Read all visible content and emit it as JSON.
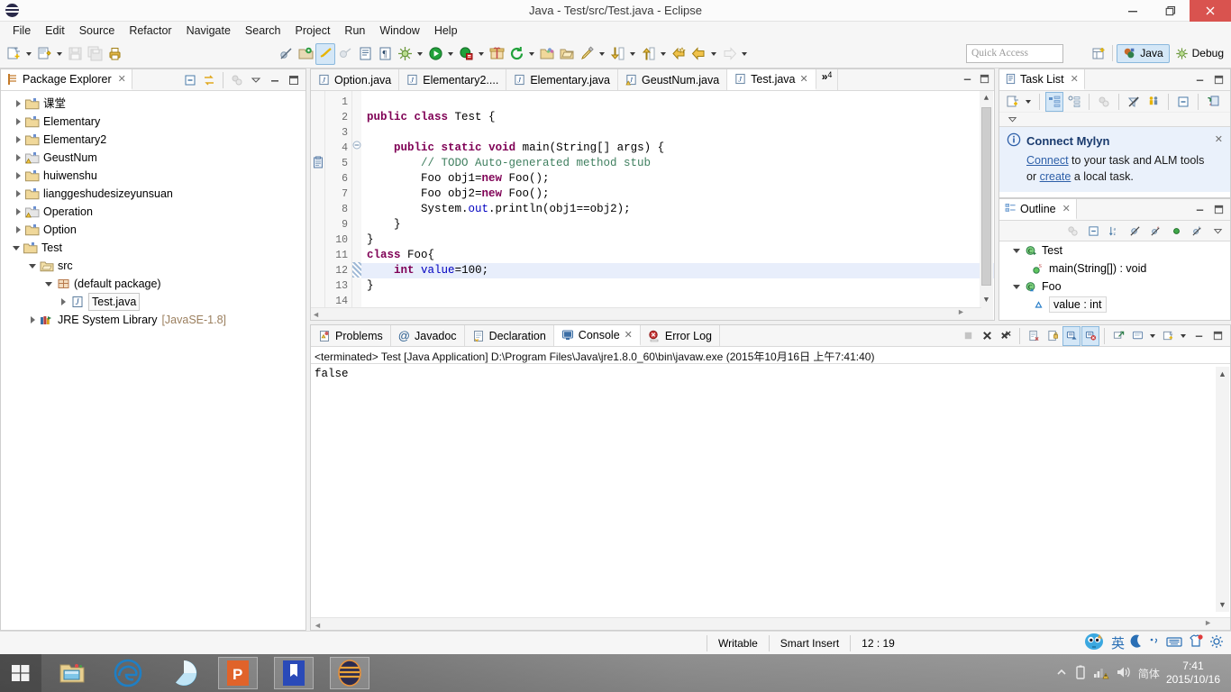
{
  "window": {
    "title": "Java - Test/src/Test.java - Eclipse",
    "minimize": "—",
    "maximize": "❐",
    "close": "✕"
  },
  "menubar": {
    "items": [
      "File",
      "Edit",
      "Source",
      "Refactor",
      "Navigate",
      "Search",
      "Project",
      "Run",
      "Window",
      "Help"
    ]
  },
  "toolbar": {
    "quick_access_placeholder": "Quick Access",
    "perspectives": [
      {
        "label": "Java",
        "active": true
      },
      {
        "label": "Debug",
        "active": false
      }
    ],
    "icons": [
      "new-wizard-icon",
      "new-java-class-icon",
      "save-icon",
      "save-all-icon",
      "print-icon",
      "toggle-mark-occurrences-icon",
      "skip-breakpoints-icon",
      "new-java-project-icon",
      "new-package-icon",
      "open-type-icon",
      "show-whitespace-icon",
      "debug-icon",
      "run-icon",
      "coverage-icon",
      "new-annotation-icon",
      "refresh-icon",
      "open-folder-icon",
      "open-package-icon",
      "search-icon",
      "next-annotation-icon",
      "previous-annotation-icon",
      "last-edit-icon",
      "back-icon",
      "forward-icon"
    ]
  },
  "package_explorer": {
    "tab_label": "Package Explorer",
    "tools": [
      "collapse-all-icon",
      "link-with-editor-icon",
      "view-menu-icon",
      "minimize-icon",
      "maximize-icon"
    ],
    "tree": [
      {
        "label": "课堂",
        "icon": "project-folder-icon",
        "indent": 0,
        "expanded": false,
        "selected": false
      },
      {
        "label": "Elementary",
        "icon": "project-folder-icon",
        "indent": 0,
        "expanded": false,
        "selected": false
      },
      {
        "label": "Elementary2",
        "icon": "project-folder-icon",
        "indent": 0,
        "expanded": false,
        "selected": false
      },
      {
        "label": "GeustNum",
        "icon": "project-warning-icon",
        "indent": 0,
        "expanded": false,
        "selected": false
      },
      {
        "label": "huiwenshu",
        "icon": "project-folder-icon",
        "indent": 0,
        "expanded": false,
        "selected": false
      },
      {
        "label": "lianggeshudesizeyunsuan",
        "icon": "project-folder-icon",
        "indent": 0,
        "expanded": false,
        "selected": false
      },
      {
        "label": "Operation",
        "icon": "project-warning-icon",
        "indent": 0,
        "expanded": false,
        "selected": false
      },
      {
        "label": "Option",
        "icon": "project-folder-icon",
        "indent": 0,
        "expanded": false,
        "selected": false
      },
      {
        "label": "Test",
        "icon": "project-folder-icon",
        "indent": 0,
        "expanded": true,
        "selected": false
      },
      {
        "label": "src",
        "icon": "source-folder-icon",
        "indent": 1,
        "expanded": true,
        "selected": false
      },
      {
        "label": "(default package)",
        "icon": "package-icon",
        "indent": 2,
        "expanded": true,
        "selected": false
      },
      {
        "label": "Test.java",
        "icon": "java-file-icon",
        "indent": 3,
        "expanded": false,
        "selected": true
      },
      {
        "label": "JRE System Library",
        "icon": "library-icon",
        "indent": 1,
        "expanded": false,
        "selected": false,
        "suffix": "[JavaSE-1.8]"
      }
    ]
  },
  "editor": {
    "tabs": [
      {
        "label": "Option.java",
        "icon": "java-file-icon",
        "active": false,
        "closable": false
      },
      {
        "label": "Elementary2....",
        "icon": "java-file-icon",
        "active": false,
        "closable": false
      },
      {
        "label": "Elementary.java",
        "icon": "java-file-icon",
        "active": false,
        "closable": false
      },
      {
        "label": "GeustNum.java",
        "icon": "java-warning-icon",
        "active": false,
        "closable": false
      },
      {
        "label": "Test.java",
        "icon": "java-file-icon",
        "active": true,
        "closable": true
      }
    ],
    "overflow_label": "»",
    "overflow_count": "4",
    "minimize": "—",
    "maximize": "❐",
    "line_numbers": [
      "1",
      "2",
      "3",
      "4",
      "5",
      "6",
      "7",
      "8",
      "9",
      "10",
      "11",
      "12",
      "13",
      "14"
    ],
    "highlighted_line": 12,
    "folding_line": 4,
    "todo_marker_line": 5,
    "lines": [
      {
        "n": 1,
        "tokens": []
      },
      {
        "n": 2,
        "tokens": [
          {
            "t": "public",
            "c": "kw"
          },
          {
            "t": " ",
            "c": "plain"
          },
          {
            "t": "class",
            "c": "kw"
          },
          {
            "t": " Test {",
            "c": "plain"
          }
        ]
      },
      {
        "n": 3,
        "tokens": []
      },
      {
        "n": 4,
        "tokens": [
          {
            "t": "    ",
            "c": "plain"
          },
          {
            "t": "public",
            "c": "kw"
          },
          {
            "t": " ",
            "c": "plain"
          },
          {
            "t": "static",
            "c": "kw"
          },
          {
            "t": " ",
            "c": "plain"
          },
          {
            "t": "void",
            "c": "kw"
          },
          {
            "t": " main(String[] args) {",
            "c": "plain"
          }
        ]
      },
      {
        "n": 5,
        "tokens": [
          {
            "t": "        ",
            "c": "plain"
          },
          {
            "t": "// TODO Auto-generated method stub",
            "c": "cm"
          }
        ]
      },
      {
        "n": 6,
        "tokens": [
          {
            "t": "        Foo obj1=",
            "c": "plain"
          },
          {
            "t": "new",
            "c": "kw"
          },
          {
            "t": " Foo();",
            "c": "plain"
          }
        ]
      },
      {
        "n": 7,
        "tokens": [
          {
            "t": "        Foo obj2=",
            "c": "plain"
          },
          {
            "t": "new",
            "c": "kw"
          },
          {
            "t": " Foo();",
            "c": "plain"
          }
        ]
      },
      {
        "n": 8,
        "tokens": [
          {
            "t": "        System.",
            "c": "plain"
          },
          {
            "t": "out",
            "c": "fld"
          },
          {
            "t": ".println(obj1==obj2);",
            "c": "plain"
          }
        ]
      },
      {
        "n": 9,
        "tokens": [
          {
            "t": "    }",
            "c": "plain"
          }
        ]
      },
      {
        "n": 10,
        "tokens": [
          {
            "t": "}",
            "c": "plain"
          }
        ]
      },
      {
        "n": 11,
        "tokens": [
          {
            "t": "class",
            "c": "kw"
          },
          {
            "t": " Foo{",
            "c": "plain"
          }
        ]
      },
      {
        "n": 12,
        "tokens": [
          {
            "t": "    ",
            "c": "plain"
          },
          {
            "t": "int",
            "c": "kw"
          },
          {
            "t": " ",
            "c": "plain"
          },
          {
            "t": "value",
            "c": "fld"
          },
          {
            "t": "=100;",
            "c": "plain"
          }
        ]
      },
      {
        "n": 13,
        "tokens": [
          {
            "t": "}",
            "c": "plain"
          }
        ]
      },
      {
        "n": 14,
        "tokens": []
      }
    ]
  },
  "task_list": {
    "tab_label": "Task List",
    "tools": [
      "new-task-icon",
      "task-dropdown-icon",
      "categorized-presentation-icon",
      "scheduled-presentation-icon",
      "focus-icon",
      "filter-completed-icon",
      "show-all-icon",
      "collapse-all-icon",
      "synchronize-icon",
      "view-menu-icon"
    ],
    "mylyn": {
      "title": "Connect Mylyn",
      "link1": "Connect",
      "text1": " to your task and ALM tools",
      "text2": "or ",
      "link2": "create",
      "text3": " a local task.",
      "close": "✕",
      "info_icon": "info-icon"
    }
  },
  "outline": {
    "tab_label": "Outline",
    "tools": [
      "focus-icon",
      "collapse-all-icon",
      "sort-icon",
      "hide-fields-icon",
      "hide-static-icon",
      "hide-non-public-icon",
      "hide-local-types-icon",
      "view-menu-icon"
    ],
    "items": [
      {
        "label": "Test",
        "icon": "class-icon",
        "indent": 0,
        "expanded": true,
        "boxed": false
      },
      {
        "label": "main(String[]) : void",
        "icon": "method-public-icon",
        "indent": 1,
        "expanded": null,
        "boxed": false,
        "static_badge": "S"
      },
      {
        "label": "Foo",
        "icon": "class-icon",
        "indent": 0,
        "expanded": true,
        "boxed": false
      },
      {
        "label": "value : int",
        "icon": "field-default-icon",
        "indent": 1,
        "expanded": null,
        "boxed": true
      }
    ]
  },
  "console": {
    "tabs": [
      {
        "label": "Problems",
        "icon": "problems-icon",
        "active": false
      },
      {
        "label": "Javadoc",
        "icon": "javadoc-icon",
        "active": false
      },
      {
        "label": "Declaration",
        "icon": "declaration-icon",
        "active": false
      },
      {
        "label": "Console",
        "icon": "console-icon",
        "active": true
      },
      {
        "label": "Error Log",
        "icon": "error-log-icon",
        "active": false
      }
    ],
    "tools": [
      "terminate-icon",
      "remove-launch-icon",
      "remove-all-terminated-icon",
      "show-console-icon",
      "pin-console-icon",
      "scroll-lock-icon",
      "word-wrap-icon",
      "display-selected-console-icon",
      "open-console-icon",
      "minimize-icon",
      "maximize-icon"
    ],
    "header": "<terminated> Test [Java Application] D:\\Program Files\\Java\\jre1.8.0_60\\bin\\javaw.exe (2015年10月16日 上午7:41:40)",
    "output": "false"
  },
  "status_bar": {
    "writable": "Writable",
    "insert_mode": "Smart Insert",
    "cursor_position": "12 : 19",
    "tray": [
      "ime-pet-icon",
      "ime-chinese-icon",
      "ime-moon-icon",
      "ime-punct-icon",
      "ime-keyboard-icon",
      "ime-tshirt-icon",
      "ime-gear-icon"
    ],
    "ime_chinese": "英"
  },
  "taskbar": {
    "start": "windows-logo-icon",
    "apps": [
      {
        "name": "file-explorer-icon",
        "running": false
      },
      {
        "name": "edge-browser-icon",
        "running": false
      },
      {
        "name": "qq-browser-icon",
        "running": false
      },
      {
        "name": "powerpoint-icon",
        "running": true
      },
      {
        "name": "wps-writer-icon",
        "running": true
      },
      {
        "name": "eclipse-icon",
        "running": true
      }
    ],
    "tray_icons": [
      "show-hidden-icons-icon",
      "battery-icon",
      "network-warning-icon",
      "volume-icon"
    ],
    "ime": "简体",
    "time": "7:41",
    "date": "2015/10/16"
  },
  "colors": {
    "accent": "#2d5fa8",
    "keyword": "#7f0055",
    "comment": "#3f7f5f",
    "field": "#0000c0",
    "selection": "#e8eefb",
    "close_red": "#d9534f"
  }
}
